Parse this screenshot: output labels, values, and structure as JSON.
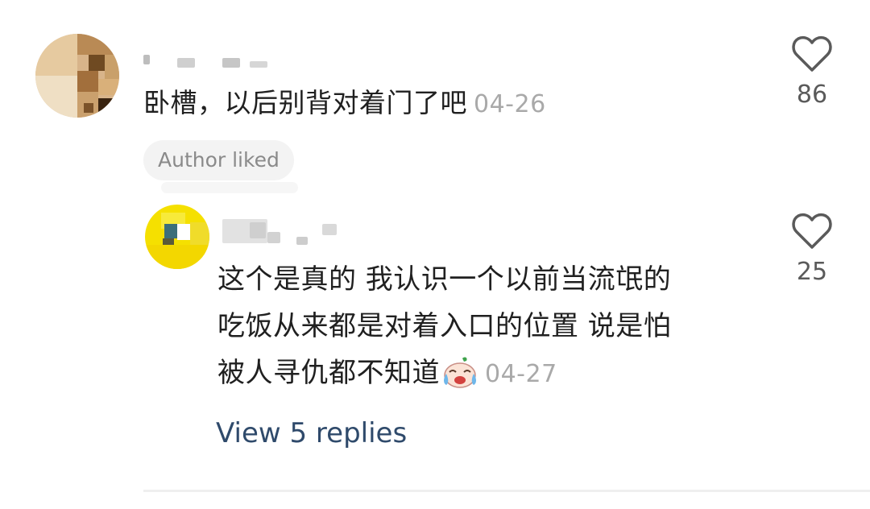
{
  "comments": [
    {
      "text": "卧槽，以后别背对着门了吧",
      "date": "04-26",
      "like_count": "86",
      "badge": "Author liked"
    },
    {
      "text_line1": "这个是真的 我认识一个以前当流氓的",
      "text_line2": "吃饭从来都是对着入口的位置 说是怕",
      "text_line3": "被人寻仇都不知道",
      "date": "04-27",
      "like_count": "25"
    }
  ],
  "view_replies_label": "View 5 replies",
  "icons": {
    "like": "heart-outline-icon",
    "emoji": "crying-face-emoji"
  },
  "colors": {
    "link": "#2f4a6b",
    "date": "#a9a9a9",
    "badge_bg": "#f3f3f3"
  }
}
